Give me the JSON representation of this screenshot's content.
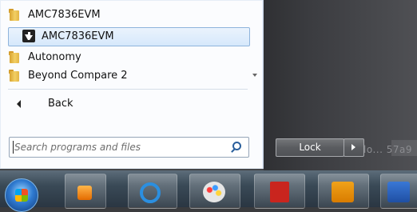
{
  "programs_list": [
    {
      "label": "AMC7836EVM",
      "type": "folder"
    },
    {
      "label": "AMC7836EVM",
      "type": "app",
      "selected": true
    },
    {
      "label": "Autonomy",
      "type": "folder"
    },
    {
      "label": "Beyond Compare 2",
      "type": "folder"
    }
  ],
  "back_label": "Back",
  "search": {
    "placeholder": "Search programs and files"
  },
  "lock_label": "Lock",
  "watermark": "lo... 57a9",
  "taskbar": {
    "icons": [
      "windows-start-orb-icon",
      "media-player-icon",
      "internet-explorer-icon",
      "paint-icon",
      "acrobat-reader-icon",
      "outlook-icon",
      "word-icon"
    ]
  },
  "colors": {
    "selection_bg": "#d6e8fb",
    "selection_border": "#8fb4dc",
    "search_icon": "#2a5f9c"
  }
}
